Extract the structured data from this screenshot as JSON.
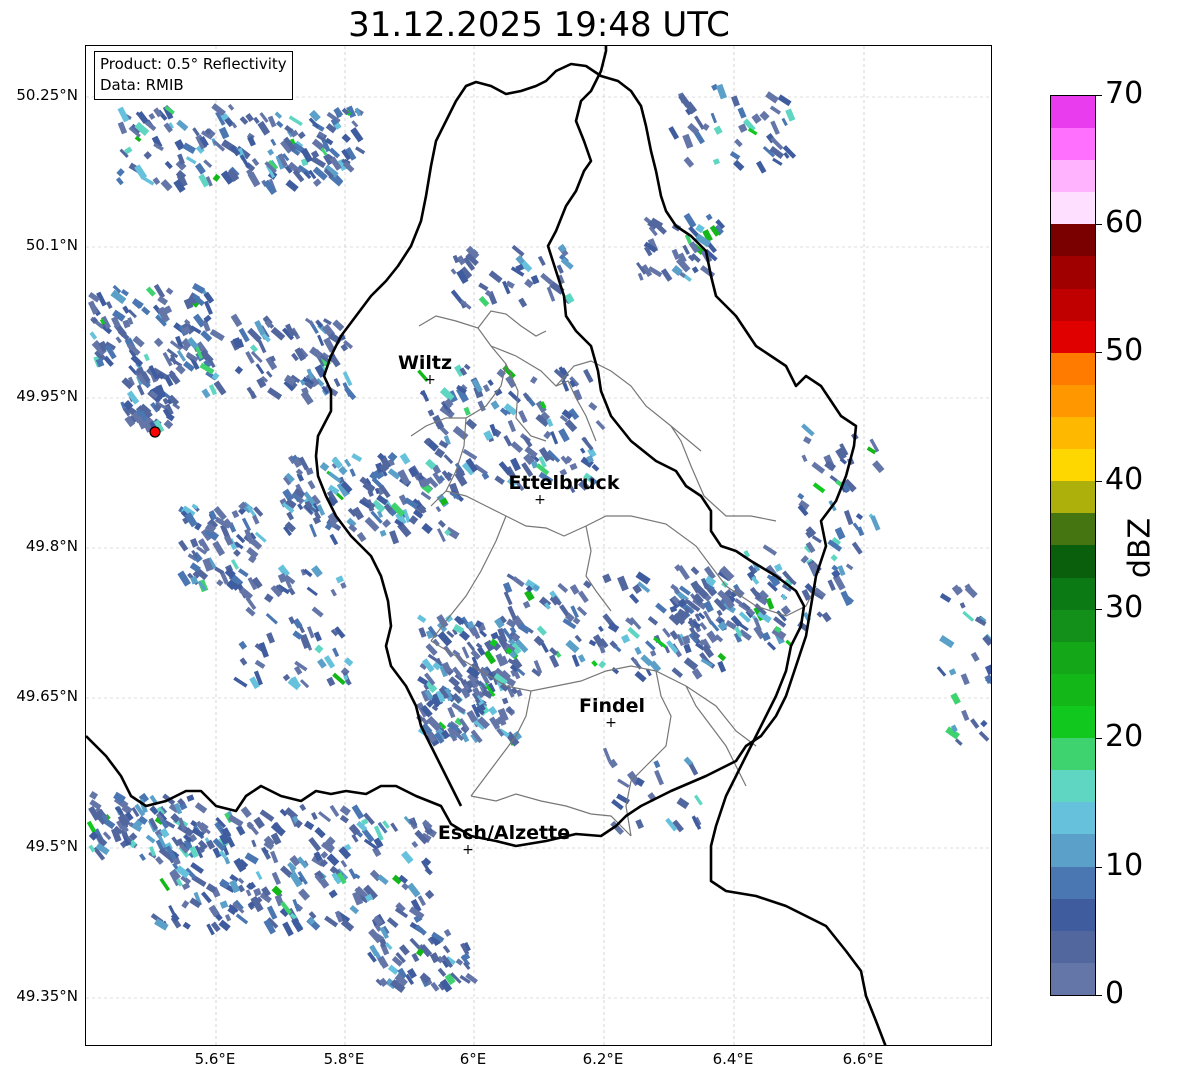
{
  "title": "31.12.2025 19:48 UTC",
  "info": {
    "product": "Product: 0.5° Reflectivity",
    "data": "Data: RMIB"
  },
  "lat_ticks": [
    "50.25°N",
    "50.1°N",
    "49.95°N",
    "49.8°N",
    "49.65°N",
    "49.5°N",
    "49.35°N"
  ],
  "lon_ticks": [
    "5.6°E",
    "5.8°E",
    "6°E",
    "6.2°E",
    "6.4°E",
    "6.6°E"
  ],
  "cities": [
    {
      "name": "Wiltz"
    },
    {
      "name": "Ettelbruck"
    },
    {
      "name": "Findel"
    },
    {
      "name": "Esch/Alzette"
    }
  ],
  "colorbar": {
    "unit": "dBZ",
    "labels": [
      "0",
      "10",
      "20",
      "30",
      "40",
      "50",
      "60",
      "70"
    ],
    "colors": [
      "#6475a8",
      "#53679f",
      "#3f5c9f",
      "#4a76b2",
      "#5aa0c9",
      "#66c2dc",
      "#5fd6c2",
      "#3fd36f",
      "#10c81e",
      "#13b818",
      "#14a718",
      "#12901a",
      "#0c7a14",
      "#0a5f0c",
      "#457510",
      "#adb00a",
      "#ffd700",
      "#ffb800",
      "#ff9800",
      "#ff7b00",
      "#e00000",
      "#c00000",
      "#a00000",
      "#7a0000",
      "#ffdfff",
      "#ffb3ff",
      "#ff70ff",
      "#e93cef"
    ]
  },
  "radar_site": {
    "color": "#ff0000"
  }
}
